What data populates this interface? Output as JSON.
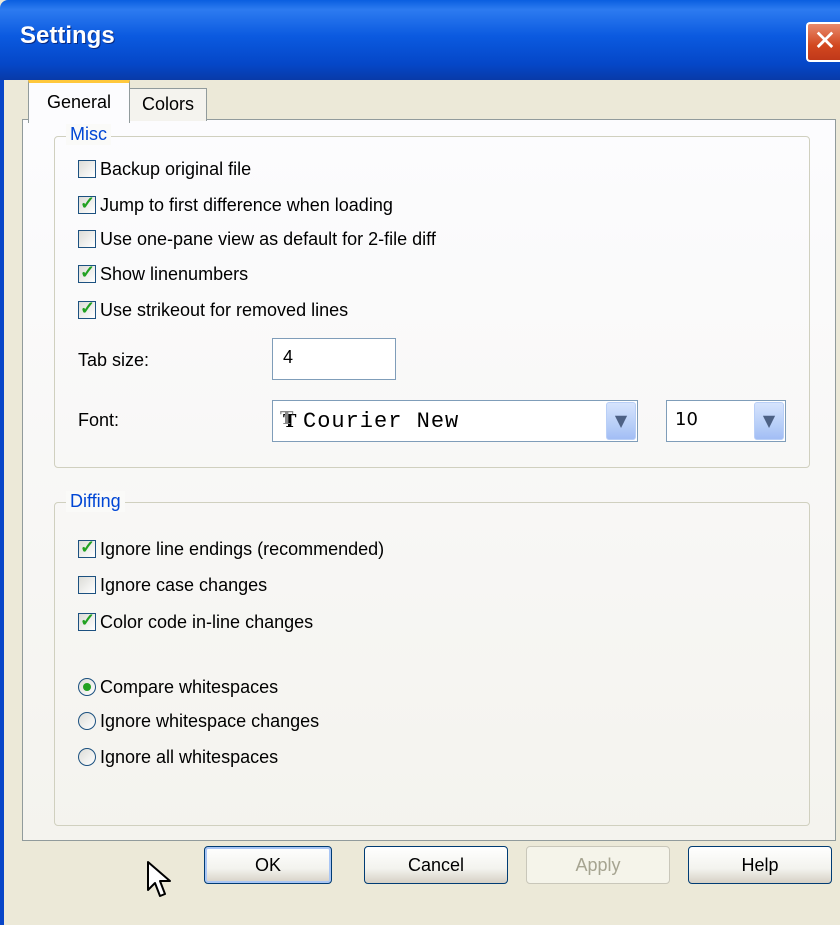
{
  "window": {
    "title": "Settings",
    "close_glyph": "✕"
  },
  "tabs": [
    {
      "label": "General",
      "selected": true
    },
    {
      "label": "Colors",
      "selected": false
    }
  ],
  "misc": {
    "legend": "Misc",
    "options": [
      {
        "label": "Backup original file",
        "checked": false
      },
      {
        "label": "Jump to first difference when loading",
        "checked": true
      },
      {
        "label": "Use one-pane view as default for 2-file diff",
        "checked": false
      },
      {
        "label": "Show linenumbers",
        "checked": true
      },
      {
        "label": "Use strikeout for removed lines",
        "checked": true
      }
    ],
    "tab_size_label": "Tab size:",
    "tab_size_value": "4",
    "font_label": "Font:",
    "font_value": "Courier New",
    "font_size_value": "10"
  },
  "diffing": {
    "legend": "Diffing",
    "options": [
      {
        "label": "Ignore line endings (recommended)",
        "checked": true
      },
      {
        "label": "Ignore case changes",
        "checked": false
      },
      {
        "label": "Color code in-line changes",
        "checked": true
      }
    ],
    "whitespace": [
      {
        "label": "Compare whitespaces",
        "selected": true
      },
      {
        "label": "Ignore whitespace changes",
        "selected": false
      },
      {
        "label": "Ignore all whitespaces",
        "selected": false
      }
    ]
  },
  "buttons": {
    "ok": "OK",
    "cancel": "Cancel",
    "apply": "Apply",
    "help": "Help"
  },
  "colors": {
    "title_bar": "#0547c8",
    "check_mark": "#21a121",
    "legend_text": "#0046d5"
  }
}
